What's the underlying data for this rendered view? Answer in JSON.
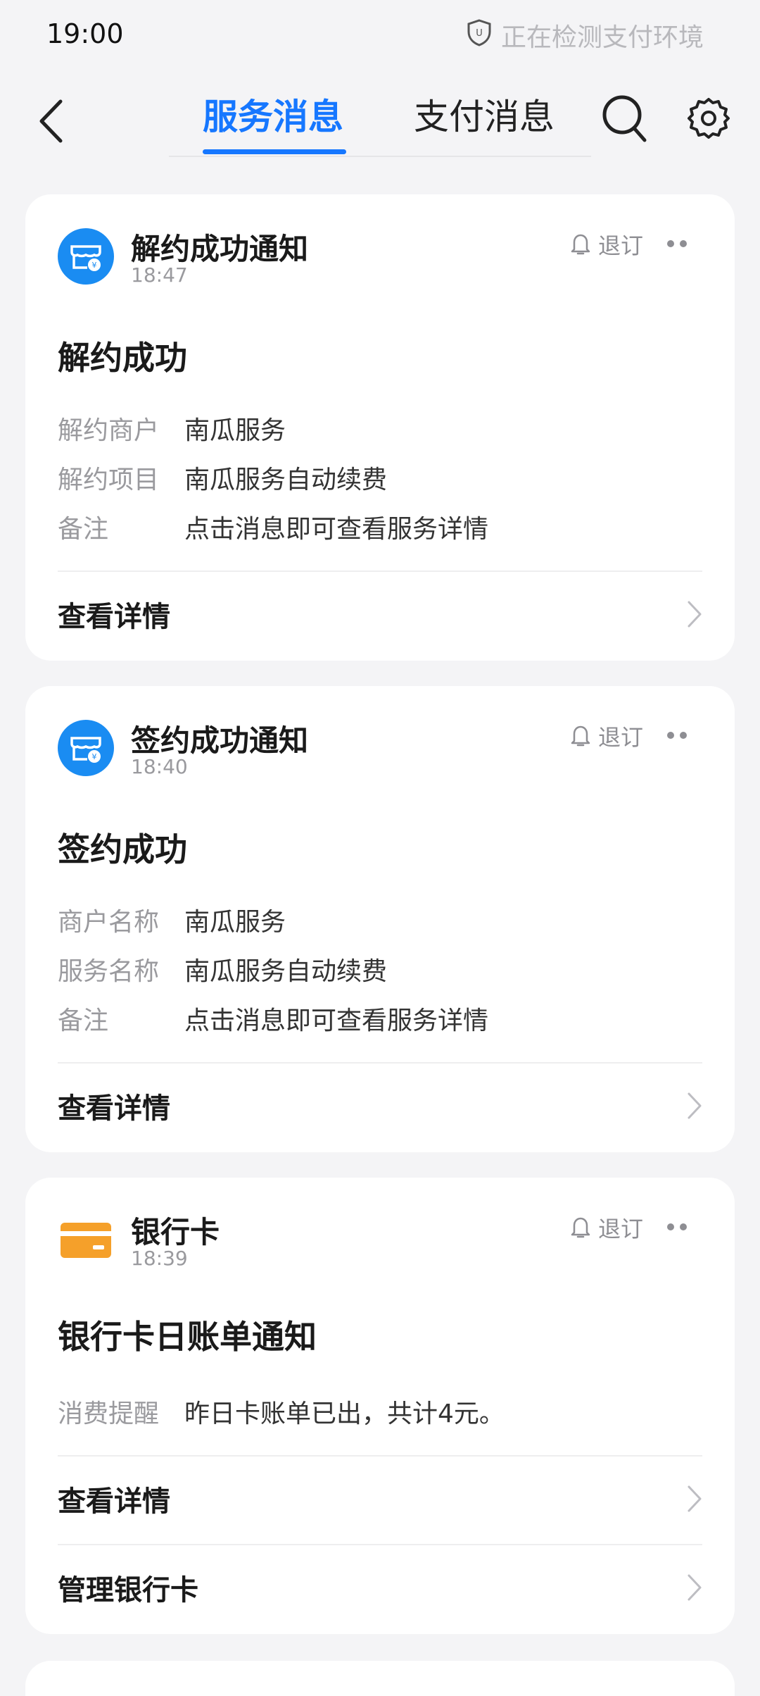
{
  "status_bar": {
    "time": "19:00",
    "env_check": "正在检测支付环境",
    "icons": [
      "shield-icon"
    ]
  },
  "nav": {
    "back_icon": "chevron-left-icon",
    "tabs": [
      {
        "label": "服务消息",
        "active": true
      },
      {
        "label": "支付消息",
        "active": false
      }
    ],
    "search_icon": "search-icon",
    "settings_icon": "gear-icon",
    "accent_color": "#1677ff"
  },
  "cards": [
    {
      "source": "解约成功通知",
      "time": "18:47",
      "unsubscribe": "退订",
      "title": "解约成功",
      "fields": [
        {
          "k": "解约商户",
          "v": "南瓜服务"
        },
        {
          "k": "解约项目",
          "v": "南瓜服务自动续费"
        },
        {
          "k": "备注",
          "v": "点击消息即可查看服务详情"
        }
      ],
      "links": [
        "查看详情"
      ]
    },
    {
      "source": "签约成功通知",
      "time": "18:40",
      "unsubscribe": "退订",
      "title": "签约成功",
      "fields": [
        {
          "k": "商户名称",
          "v": "南瓜服务"
        },
        {
          "k": "服务名称",
          "v": "南瓜服务自动续费"
        },
        {
          "k": "备注",
          "v": "点击消息即可查看服务详情"
        }
      ],
      "links": [
        "查看详情"
      ]
    },
    {
      "source": "银行卡",
      "time": "18:39",
      "unsubscribe": "退订",
      "title": "银行卡日账单通知",
      "fields": [
        {
          "k": "消费提醒",
          "v": "昨日卡账单已出，共计4元。"
        }
      ],
      "links": [
        "查看详情",
        "管理银行卡"
      ]
    }
  ]
}
